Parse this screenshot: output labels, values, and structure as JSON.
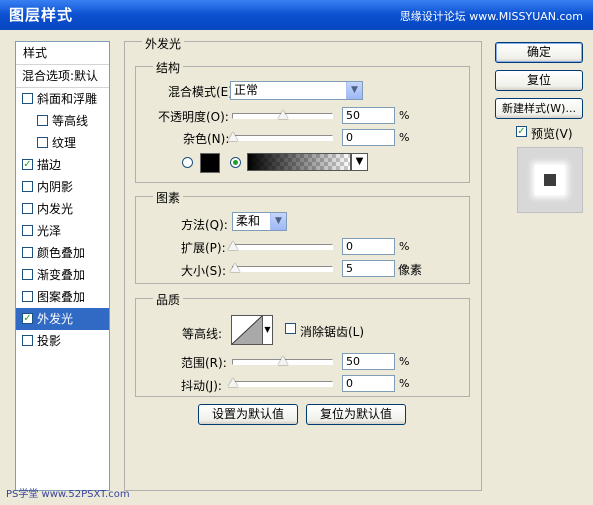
{
  "window": {
    "title": "图层样式",
    "watermark": "思缘设计论坛 www.MISSYUAN.com"
  },
  "left_panel": {
    "header": "样式",
    "blend_options": "混合选项:默认",
    "items": [
      {
        "label": "斜面和浮雕",
        "checked": false,
        "sub": false,
        "selected": false
      },
      {
        "label": "等高线",
        "checked": false,
        "sub": true,
        "selected": false
      },
      {
        "label": "纹理",
        "checked": false,
        "sub": true,
        "selected": false
      },
      {
        "label": "描边",
        "checked": true,
        "sub": false,
        "selected": false
      },
      {
        "label": "内阴影",
        "checked": false,
        "sub": false,
        "selected": false
      },
      {
        "label": "内发光",
        "checked": false,
        "sub": false,
        "selected": false
      },
      {
        "label": "光泽",
        "checked": false,
        "sub": false,
        "selected": false
      },
      {
        "label": "颜色叠加",
        "checked": false,
        "sub": false,
        "selected": false
      },
      {
        "label": "渐变叠加",
        "checked": false,
        "sub": false,
        "selected": false
      },
      {
        "label": "图案叠加",
        "checked": false,
        "sub": false,
        "selected": false
      },
      {
        "label": "外发光",
        "checked": true,
        "sub": false,
        "selected": true
      },
      {
        "label": "投影",
        "checked": false,
        "sub": false,
        "selected": false
      }
    ]
  },
  "outer_glow": {
    "title": "外发光",
    "structure": {
      "title": "结构",
      "blend_mode_label": "混合模式(E):",
      "blend_mode_value": "正常",
      "opacity_label": "不透明度(O):",
      "opacity_value": "50",
      "opacity_unit": "%",
      "opacity_level": 0.5,
      "noise_label": "杂色(N):",
      "noise_value": "0",
      "noise_unit": "%",
      "noise_level": 0,
      "color_mode": "gradient"
    },
    "elements": {
      "title": "图素",
      "method_label": "方法(Q):",
      "method_value": "柔和",
      "spread_label": "扩展(P):",
      "spread_value": "0",
      "spread_unit": "%",
      "spread_level": 0,
      "size_label": "大小(S):",
      "size_value": "5",
      "size_unit": "像素",
      "size_level": 0.02
    },
    "quality": {
      "title": "品质",
      "contour_label": "等高线:",
      "antialias_label": "消除锯齿(L)",
      "antialias_checked": false,
      "range_label": "范围(R):",
      "range_value": "50",
      "range_unit": "%",
      "range_level": 0.5,
      "jitter_label": "抖动(J):",
      "jitter_value": "0",
      "jitter_unit": "%",
      "jitter_level": 0
    },
    "set_default_label": "设置为默认值",
    "reset_default_label": "复位为默认值"
  },
  "buttons": {
    "ok": "确定",
    "reset": "复位",
    "new_style": "新建样式(W)...",
    "preview_label": "预览(V)",
    "preview_checked": true
  },
  "footer": {
    "text": "PS学堂 www.52PSXT.com"
  },
  "colors": {
    "title_bar": "#0a50d0",
    "selection": "#316ac5",
    "dialog_bg": "#ece9d8",
    "check": "#21a121"
  }
}
